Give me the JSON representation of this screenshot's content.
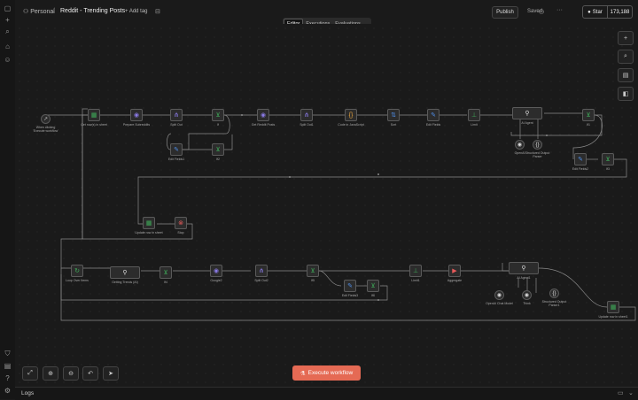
{
  "breadcrumb": {
    "project": "Personal",
    "separator": "/",
    "workflow": "Reddit - Trending Posts",
    "add_tag": "+ Add tag"
  },
  "header": {
    "publish": "Publish",
    "saved": "Saved",
    "more": "···",
    "github_star": "Star",
    "github_count": "173,188"
  },
  "tabs": [
    {
      "label": "Editor",
      "active": true
    },
    {
      "label": "Executions",
      "active": false
    },
    {
      "label": "Evaluations",
      "active": false
    }
  ],
  "execute_button": "Execute workflow",
  "logs_label": "Logs",
  "colors": {
    "accent": "#e56a54",
    "green": "#3fae5a",
    "purple": "#8a7ae6",
    "blue": "#4f8ee8",
    "node_border": "#5a5a5a",
    "wire": "#8a8a8a"
  },
  "nodes": [
    {
      "name": "trigger",
      "icon": "↗",
      "color": "#bbb",
      "label": "When clicking 'Execute workflow'"
    },
    {
      "name": "sheets1",
      "icon": "▦",
      "color": "#3fae5a",
      "label": "Get row(s) in sheet"
    },
    {
      "name": "prep",
      "icon": "◉",
      "color": "#8a7ae6",
      "label": "Prepare Subreddits"
    },
    {
      "name": "split1",
      "icon": "⋔",
      "color": "#8a7ae6",
      "label": "Split Out"
    },
    {
      "name": "filter1",
      "icon": "⊻",
      "color": "#3fae5a",
      "label": "If"
    },
    {
      "name": "http1",
      "icon": "◉",
      "color": "#8a7ae6",
      "label": "Get Reddit Posts"
    },
    {
      "name": "split2",
      "icon": "⋔",
      "color": "#8a7ae6",
      "label": "Split Out1"
    },
    {
      "name": "code1",
      "icon": "{}",
      "color": "#e8a33d",
      "label": "Code in JavaScript"
    },
    {
      "name": "sort1",
      "icon": "⇅",
      "color": "#4f8ee8",
      "label": "Sort"
    },
    {
      "name": "edit1",
      "icon": "✎",
      "color": "#4f8ee8",
      "label": "Edit Fields"
    },
    {
      "name": "limit1",
      "icon": "⊥",
      "color": "#3fae5a",
      "label": "Limit"
    },
    {
      "name": "agent1",
      "icon": "⚲",
      "color": "#ddd",
      "label": "AI Agent"
    },
    {
      "name": "filter2",
      "icon": "⊻",
      "color": "#3fae5a",
      "label": "If1"
    },
    {
      "name": "edit2",
      "icon": "✎",
      "color": "#4f8ee8",
      "label": "Edit Fields1"
    },
    {
      "name": "filter3",
      "icon": "⊻",
      "color": "#3fae5a",
      "label": "If2"
    },
    {
      "name": "sub1",
      "icon": "◉",
      "color": "#ddd",
      "label": "OpenAI"
    },
    {
      "name": "sub2",
      "icon": "{}",
      "color": "#ddd",
      "label": "Structured Output Parser"
    },
    {
      "name": "edit3",
      "icon": "✎",
      "color": "#4f8ee8",
      "label": "Edit Fields2"
    },
    {
      "name": "filter4",
      "icon": "⊻",
      "color": "#3fae5a",
      "label": "If3"
    },
    {
      "name": "sheets2",
      "icon": "▦",
      "color": "#3fae5a",
      "label": "Update row in sheet"
    },
    {
      "name": "stop1",
      "icon": "⊗",
      "color": "#e85a5a",
      "label": "Stop"
    },
    {
      "name": "schedule",
      "icon": "↻",
      "color": "#3fae5a",
      "label": "Loop Over Items"
    },
    {
      "name": "agent2",
      "icon": "⚲",
      "color": "#ddd",
      "label": "Getting Trends (AI)"
    },
    {
      "name": "filter5",
      "icon": "⊻",
      "color": "#3fae5a",
      "label": "If4"
    },
    {
      "name": "http2",
      "icon": "◉",
      "color": "#8a7ae6",
      "label": "Google2"
    },
    {
      "name": "split3",
      "icon": "⋔",
      "color": "#8a7ae6",
      "label": "Split Out2"
    },
    {
      "name": "filter6",
      "icon": "⊻",
      "color": "#3fae5a",
      "label": "If5"
    },
    {
      "name": "edit4",
      "icon": "✎",
      "color": "#4f8ee8",
      "label": "Edit Fields3"
    },
    {
      "name": "filter7",
      "icon": "⊻",
      "color": "#3fae5a",
      "label": "If6"
    },
    {
      "name": "limit2",
      "icon": "⊥",
      "color": "#3fae5a",
      "label": "Limit1"
    },
    {
      "name": "youtube",
      "icon": "▶",
      "color": "#e85a5a",
      "label": "Aggregate"
    },
    {
      "name": "agent3",
      "icon": "⚲",
      "color": "#ddd",
      "label": "AI Agent1"
    },
    {
      "name": "sub3",
      "icon": "◉",
      "color": "#ddd",
      "label": "OpenAI Chat Model"
    },
    {
      "name": "sub4",
      "icon": "◉",
      "color": "#ddd",
      "label": "Think"
    },
    {
      "name": "sub5",
      "icon": "{}",
      "color": "#ddd",
      "label": "Structured Output Parser1"
    },
    {
      "name": "sheets3",
      "icon": "▦",
      "color": "#3fae5a",
      "label": "Update row in sheet1"
    }
  ]
}
